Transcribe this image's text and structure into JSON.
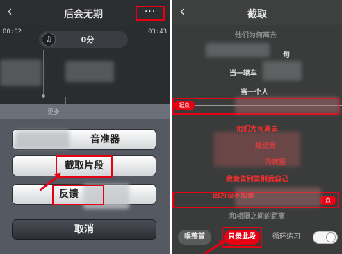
{
  "left": {
    "header": {
      "title": "后会无期",
      "more_icon": "···"
    },
    "player": {
      "elapsed": "00:02",
      "total": "03:43",
      "score": "0分"
    },
    "sheet": {
      "hint": "更多",
      "buttons": [
        {
          "label": "音准器"
        },
        {
          "label": "截取片段"
        },
        {
          "label": "反馈"
        },
        {
          "label": "取消"
        }
      ]
    }
  },
  "right": {
    "header": {
      "title": "截取"
    },
    "lyrics": [
      {
        "text": "他们为何离去",
        "style": "white"
      },
      {
        "text": "句",
        "style": "white"
      },
      {
        "text": "当一辆车",
        "style": "white"
      },
      {
        "text": "当一个人",
        "style": "white"
      },
      {
        "text": "他们为何离去",
        "style": "red"
      },
      {
        "text": "是结局",
        "style": "red"
      },
      {
        "text": "的夜里",
        "style": "red"
      },
      {
        "text": "我会告别告别我自己",
        "style": "red"
      },
      {
        "text": "因为我不知道",
        "style": "red"
      },
      {
        "text": "和相隔之间的距离",
        "style": "dim"
      }
    ],
    "start_marker": "起点",
    "end_marker": "点",
    "controls": {
      "sing_all": "唱整首",
      "record_segment": "只录此段",
      "loop_label": "循环练习"
    }
  },
  "colors": {
    "highlight": "#e60012",
    "lyric_active": "#ff2d2d"
  }
}
